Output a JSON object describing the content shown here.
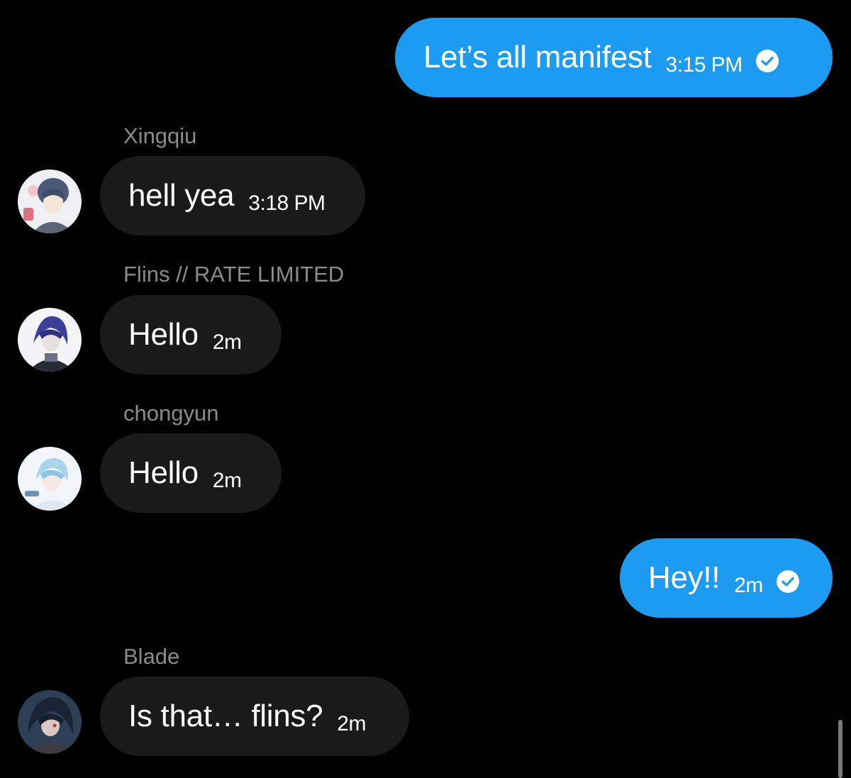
{
  "colors": {
    "background": "#000000",
    "outgoing_bubble": "#1D9BF0",
    "incoming_bubble": "#1A1A1A",
    "sender_name": "#8B8B8B",
    "text": "#FFFFFF"
  },
  "messages": [
    {
      "direction": "outgoing",
      "text": "Let’s all manifest",
      "time": "3:15 PM",
      "status_icon": "check-circle-icon"
    },
    {
      "direction": "incoming",
      "sender": "Xingqiu",
      "text": "hell yea",
      "time": "3:18 PM",
      "avatar_icon": "xingqiu-avatar"
    },
    {
      "direction": "incoming",
      "sender": "Flins // RATE LIMITED",
      "text": "Hello",
      "time": "2m",
      "avatar_icon": "flins-avatar"
    },
    {
      "direction": "incoming",
      "sender": "chongyun",
      "text": "Hello",
      "time": "2m",
      "avatar_icon": "chongyun-avatar"
    },
    {
      "direction": "outgoing",
      "text": "Hey!!",
      "time": "2m",
      "status_icon": "check-circle-icon"
    },
    {
      "direction": "incoming",
      "sender": "Blade",
      "text": "Is that… flins?",
      "time": "2m",
      "avatar_icon": "blade-avatar"
    }
  ]
}
